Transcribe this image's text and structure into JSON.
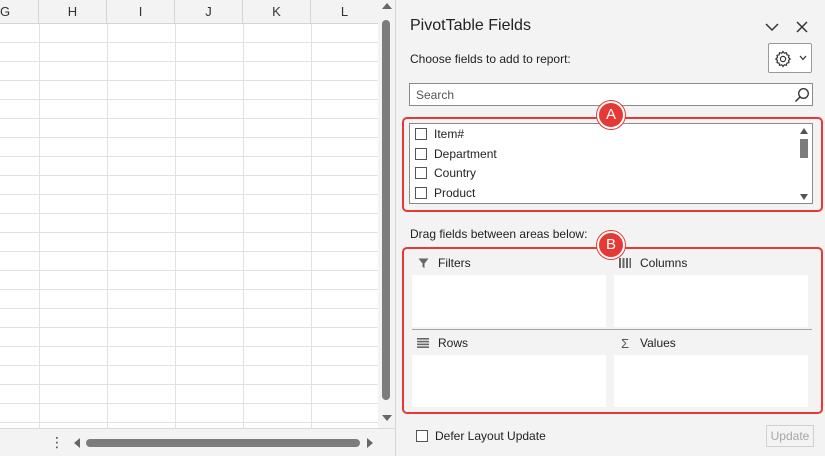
{
  "sheet": {
    "columns": [
      "G",
      "H",
      "I",
      "J",
      "K",
      "L"
    ]
  },
  "pane": {
    "title": "PivotTable Fields",
    "choose_label": "Choose fields to add to report:",
    "search_placeholder": "Search",
    "fields": [
      {
        "label": "Item#",
        "checked": false
      },
      {
        "label": "Department",
        "checked": false
      },
      {
        "label": "Country",
        "checked": false
      },
      {
        "label": "Product",
        "checked": false
      }
    ],
    "drag_label": "Drag fields between areas below:",
    "areas": {
      "filters": "Filters",
      "columns": "Columns",
      "rows": "Rows",
      "values": "Values"
    },
    "defer_label": "Defer Layout Update",
    "update_label": "Update"
  },
  "callouts": {
    "a": "A",
    "b": "B"
  },
  "colors": {
    "callout": "#e53935",
    "pane_background": "#f3f3f3"
  },
  "icons": [
    "collapse-chevron-icon",
    "close-icon",
    "gear-icon",
    "search-icon",
    "filter-icon",
    "columns-icon",
    "rows-icon",
    "sigma-icon",
    "more-icon"
  ]
}
